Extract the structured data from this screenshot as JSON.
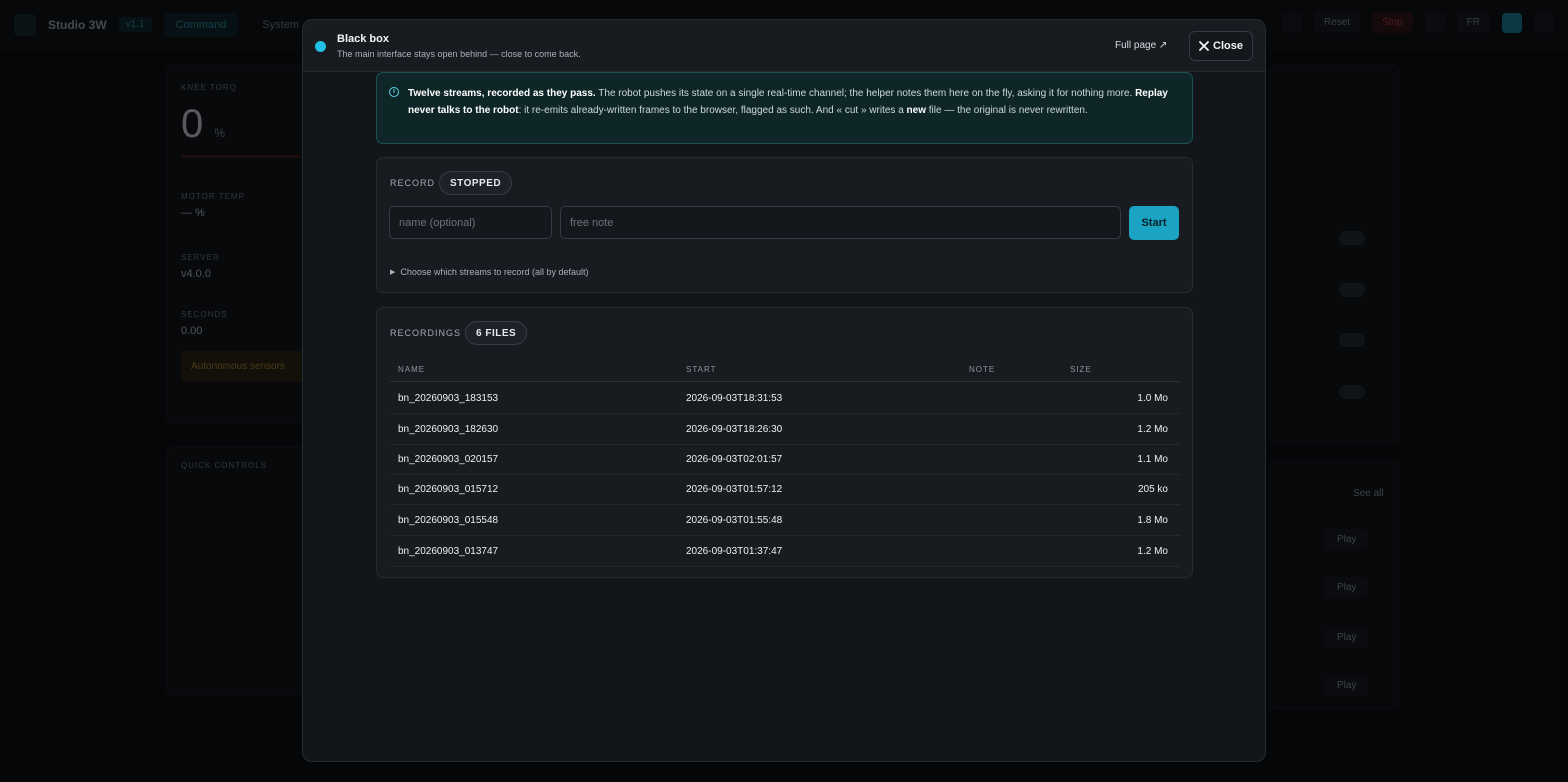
{
  "background": {
    "brand": "Studio 3W",
    "version": "v1.1",
    "tabs": [
      "Command",
      "System"
    ],
    "right_buttons": [
      "Reset",
      "Stop"
    ],
    "lang": "FR",
    "panels": {
      "first_label": "Knee torq",
      "big_value": "0",
      "big_unit": "%",
      "motor_label": "Motor temp",
      "motor_value": "— %",
      "server_label": "Server",
      "server_value": "v4.0.0",
      "second_label": "Seconds",
      "second_value": "0.00",
      "warning": "Autonomous sensors",
      "quick_label": "Quick controls",
      "see_all": "See all",
      "play": "Play"
    }
  },
  "modal": {
    "title": "Black box",
    "subtitle": "The main interface stays open behind — close to come back.",
    "full_page": "Full page ↗",
    "close": "Close",
    "info": {
      "lead_bold": "Twelve streams, recorded as they pass.",
      "lead_text": " The robot pushes its state on a single real-time channel; the helper notes them here on the fly, asking it for nothing more. ",
      "replay_bold": "Replay never talks to the robot",
      "replay_text": ": it re-emits already-written frames to the browser, flagged as such. And « cut » writes a ",
      "new_bold": "new",
      "tail_text": " file — the original is never rewritten."
    },
    "record": {
      "label": "RECORD",
      "status": "STOPPED",
      "name_placeholder": "name (optional)",
      "note_placeholder": "free note",
      "start": "Start",
      "streams_toggle": "Choose which streams to record (all by default)"
    },
    "recordings": {
      "label": "RECORDINGS",
      "count": "6 FILES",
      "columns": [
        "NAME",
        "START",
        "NOTE",
        "SIZE"
      ],
      "rows": [
        {
          "name": "bn_20260903_183153",
          "start": "2026-09-03T18:31:53",
          "note": "",
          "size": "1.0 Mo"
        },
        {
          "name": "bn_20260903_182630",
          "start": "2026-09-03T18:26:30",
          "note": "",
          "size": "1.2 Mo"
        },
        {
          "name": "bn_20260903_020157",
          "start": "2026-09-03T02:01:57",
          "note": "",
          "size": "1.1 Mo"
        },
        {
          "name": "bn_20260903_015712",
          "start": "2026-09-03T01:57:12",
          "note": "",
          "size": "205 ko"
        },
        {
          "name": "bn_20260903_015548",
          "start": "2026-09-03T01:55:48",
          "note": "",
          "size": "1.8 Mo"
        },
        {
          "name": "bn_20260903_013747",
          "start": "2026-09-03T01:37:47",
          "note": "",
          "size": "1.2 Mo"
        }
      ]
    }
  },
  "colors": {
    "accent": "#1aa3c3",
    "status_dot": "#23c0e6",
    "info_bg": "#0f2628",
    "danger": "#e04a55"
  }
}
